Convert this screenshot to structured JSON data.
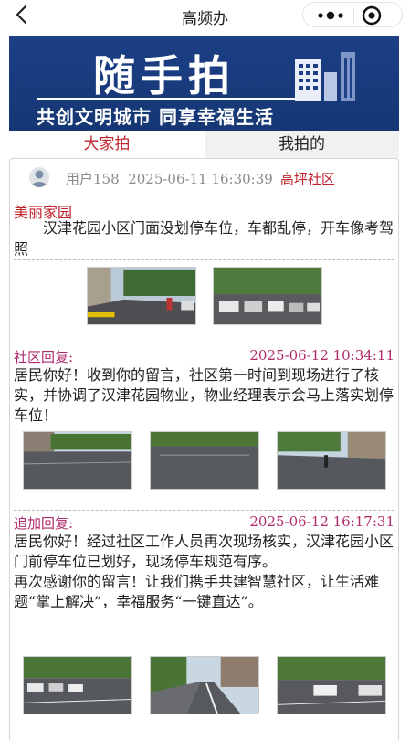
{
  "navbar": {
    "title": "高频办"
  },
  "banner": {
    "headline": "随手拍",
    "slogan": "共创文明城市 同享幸福生活"
  },
  "tabs": [
    {
      "label": "大家拍"
    },
    {
      "label": "我拍的"
    }
  ],
  "post": {
    "user": "用户158",
    "time": "2025-06-11 16:30:39",
    "community": "高坪社区",
    "category": "美丽家园",
    "content": "汉津花园小区门面没划停车位，车都乱停，开车像考驾照"
  },
  "replies": [
    {
      "label": "社区回复:",
      "time": "2025-06-12 10:34:11",
      "paragraphs": [
        "居民你好！收到你的留言，社区第一时间到现场进行了核实，并协调了汉津花园物业，物业经理表示会马上落实划停车位！"
      ]
    },
    {
      "label": "追加回复:",
      "time": "2025-06-12 16:17:31",
      "paragraphs": [
        "居民你好！经过社区工作人员再次现场核实，汉津花园小区门前停车位已划好，现场停车规范有序。",
        "再次感谢你的留言！让我们携手共建智慧社区，让生活难题“掌上解决”，幸福服务“一键直达”。"
      ]
    }
  ],
  "colors": {
    "accent": "#c0242c",
    "reply": "#b02a6a",
    "banner": "#1c3f86"
  },
  "icons": [
    "back-icon",
    "more-icon",
    "close-icon",
    "avatar-icon",
    "building-icon"
  ]
}
